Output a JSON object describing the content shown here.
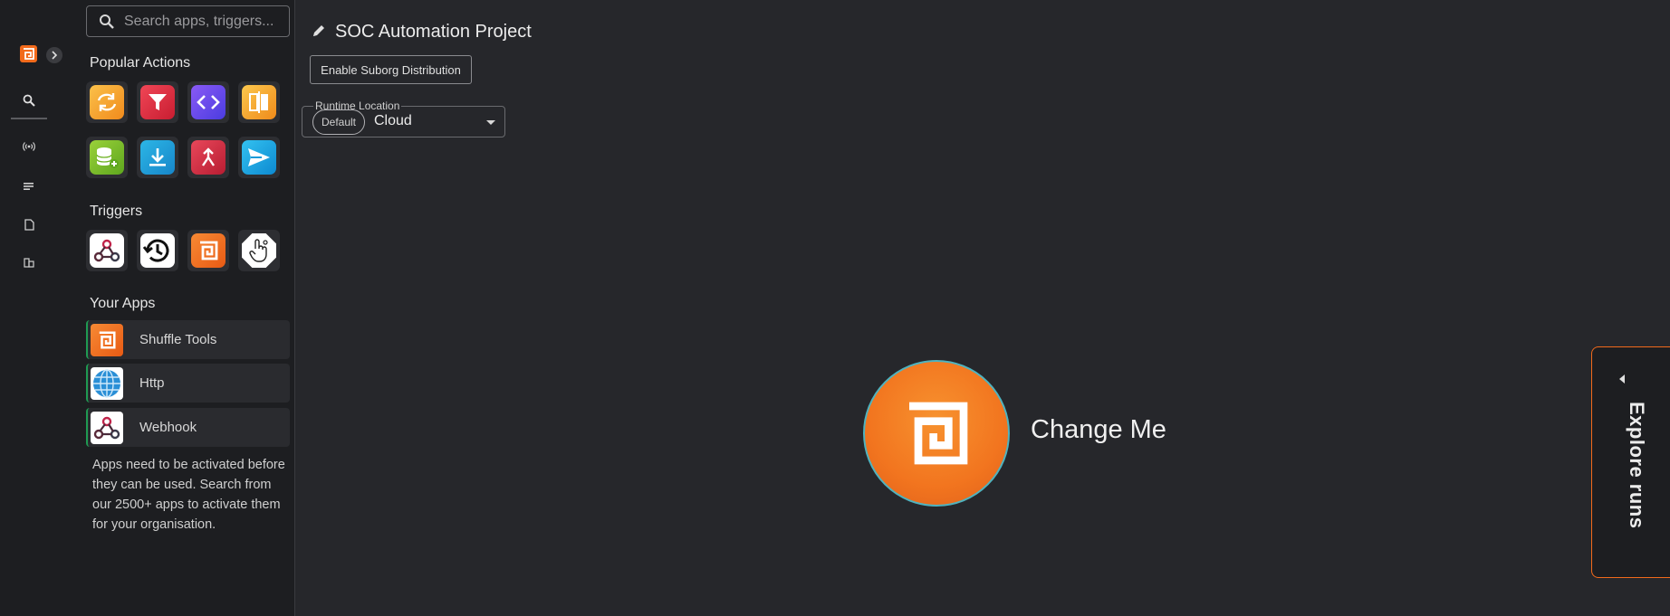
{
  "search": {
    "placeholder": "Search apps, triggers..."
  },
  "sections": {
    "popular_actions": "Popular Actions",
    "triggers": "Triggers",
    "your_apps": "Your Apps"
  },
  "popular_actions": [
    {
      "icon": "repeat-arrows-icon",
      "color": "#f5a02a"
    },
    {
      "icon": "filter-icon",
      "color": "#e02d3c"
    },
    {
      "icon": "code-brackets-icon",
      "color": "#6a4cf0"
    },
    {
      "icon": "compare-split-icon",
      "color": "#f29c1f"
    },
    {
      "icon": "database-add-icon",
      "color": "#7bbf2a"
    },
    {
      "icon": "download-icon",
      "color": "#1f9cd6"
    },
    {
      "icon": "merge-arrow-icon",
      "color": "#d62a3d"
    },
    {
      "icon": "send-icon",
      "color": "#1ea6e0"
    }
  ],
  "triggers": [
    {
      "icon": "webhook-icon"
    },
    {
      "icon": "schedule-history-icon"
    },
    {
      "icon": "shuffle-logo-icon",
      "color": "#f26a1b"
    },
    {
      "icon": "user-input-hand-icon"
    }
  ],
  "apps": [
    {
      "label": "Shuffle Tools",
      "icon": "shuffle-logo-icon",
      "color": "#f26a1b"
    },
    {
      "label": "Http",
      "icon": "globe-icon",
      "color": "#1f6fb8"
    },
    {
      "label": "Webhook",
      "icon": "webhook-icon",
      "color": "#ffffff"
    }
  ],
  "help_text": "Apps need to be activated before they can be used. Search from our 2500+ apps to activate them for your organisation.",
  "workflow": {
    "title": "SOC Automation Project",
    "suborg_button": "Enable Suborg Distribution",
    "runtime_label": "Runtime Location",
    "runtime_chip": "Default",
    "runtime_value": "Cloud"
  },
  "node": {
    "label": "Change Me",
    "color": "#f2751f"
  },
  "explore": {
    "label": "Explore runs",
    "accent": "#f26a1b"
  }
}
